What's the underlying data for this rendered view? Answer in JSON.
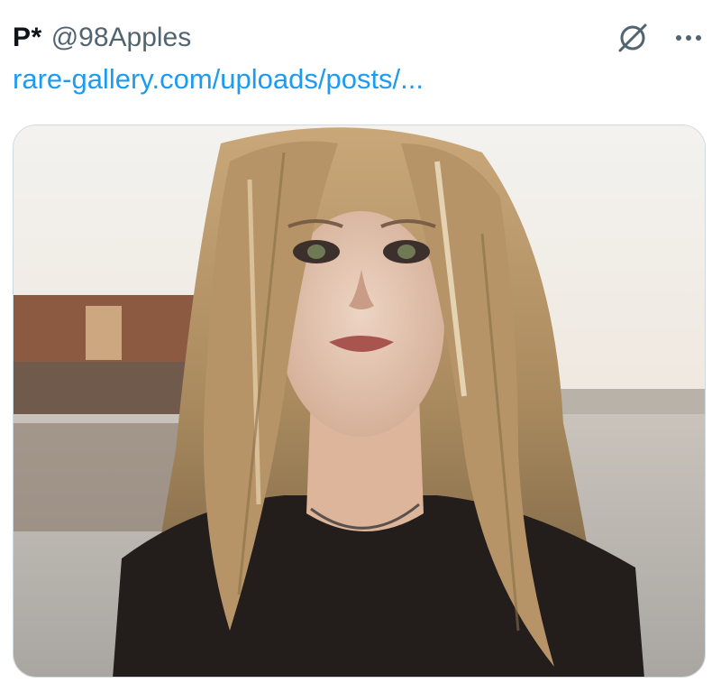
{
  "post": {
    "display_name": "P*",
    "handle": "@98Apples",
    "link_text": "rare-gallery.com/uploads/posts/...",
    "icons": {
      "mute": "mute-circle-slash-icon",
      "more": "more-dots-icon"
    },
    "colors": {
      "link": "#1d9bf0",
      "handle": "#536471",
      "name": "#0f1419",
      "border": "#cfd9de"
    }
  }
}
